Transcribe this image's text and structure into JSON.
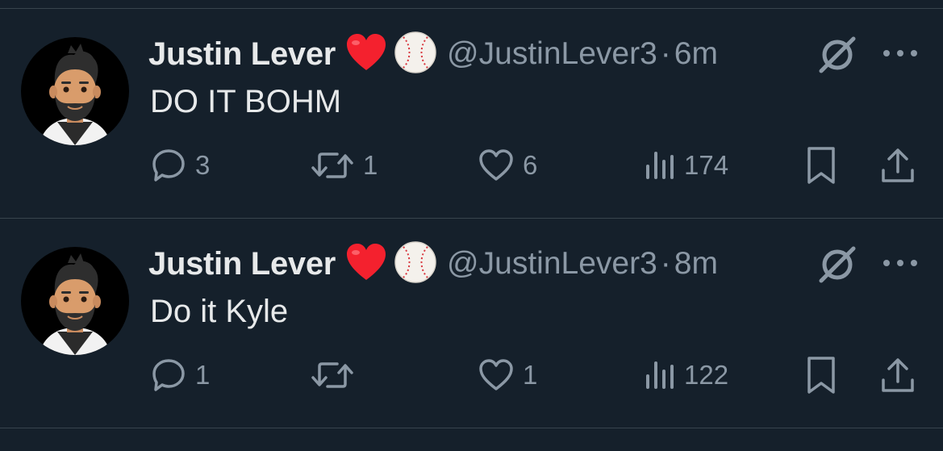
{
  "colors": {
    "background": "#15202b",
    "text": "#e7e9ea",
    "muted": "#8b98a5",
    "divider": "#38444d",
    "heart": "#f4212e"
  },
  "tweets": [
    {
      "author": "Justin Lever",
      "emojis": [
        "heart-emoji",
        "baseball-emoji"
      ],
      "handle": "@JustinLever3",
      "separator": "·",
      "time": "6m",
      "text": "DO IT BOHM",
      "replies": "3",
      "reposts": "1",
      "likes": "6",
      "views": "174"
    },
    {
      "author": "Justin Lever",
      "emojis": [
        "heart-emoji",
        "baseball-emoji"
      ],
      "handle": "@JustinLever3",
      "separator": "·",
      "time": "8m",
      "text": "Do it Kyle",
      "replies": "1",
      "reposts": "",
      "likes": "1",
      "views": "122"
    }
  ]
}
